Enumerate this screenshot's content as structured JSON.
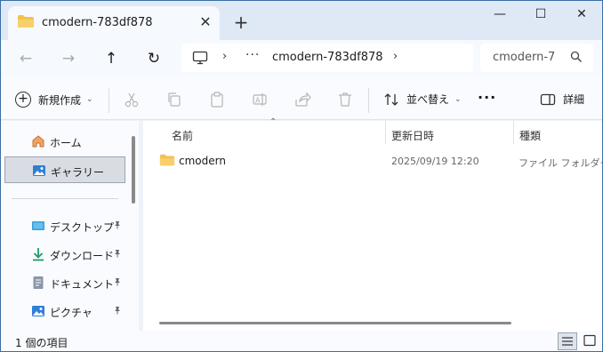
{
  "tab": {
    "title": "cmodern-783df878",
    "close_glyph": "✕",
    "new_tab_glyph": "+"
  },
  "window_controls": {
    "minimize": "—",
    "maximize": "☐",
    "close": "✕"
  },
  "nav": {
    "back": "←",
    "forward": "→",
    "up": "↑",
    "refresh": "↻"
  },
  "address": {
    "chevron1": "›",
    "ellipsis": "···",
    "folder": "cmodern-783df878",
    "chevron2": "›"
  },
  "search": {
    "text": "cmodern-7"
  },
  "toolbar": {
    "new_label": "新規作成",
    "sort_label": "並べ替え",
    "more_label": "···",
    "details_label": "詳細",
    "caret": "⌄"
  },
  "sidebar": {
    "items": [
      {
        "label": "ホーム",
        "icon": "home-icon"
      },
      {
        "label": "ギャラリー",
        "icon": "gallery-icon"
      },
      {
        "label": "デスクトップ",
        "icon": "desktop-icon"
      },
      {
        "label": "ダウンロード",
        "icon": "download-icon"
      },
      {
        "label": "ドキュメント",
        "icon": "document-icon"
      },
      {
        "label": "ピクチャ",
        "icon": "pictures-icon"
      }
    ],
    "pin_glyph": "📌"
  },
  "content": {
    "sort_arrow": "⌃",
    "columns": {
      "name": "名前",
      "modified": "更新日時",
      "type": "種類"
    },
    "rows": [
      {
        "name": "cmodern",
        "modified": "2025/09/19 12:20",
        "type": "ファイル フォルダー"
      }
    ]
  },
  "status": {
    "count": "1 個の項目"
  },
  "colors": {
    "accent": "#0067c0",
    "folder": "#f4c14e",
    "border": "#3a6ea5"
  }
}
